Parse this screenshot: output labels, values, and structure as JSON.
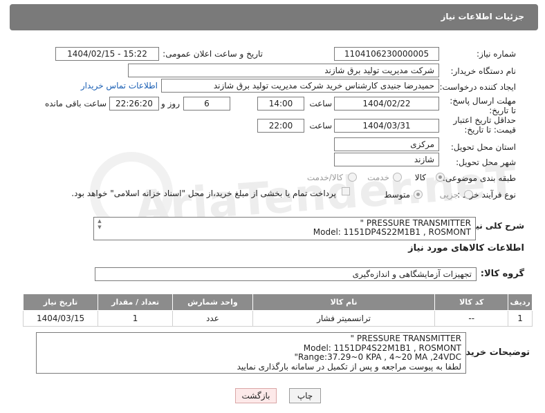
{
  "header": {
    "title": "جزئیات اطلاعات نیاز"
  },
  "watermark": "AriaTender.neT",
  "form": {
    "need_number": {
      "label": "شماره نیاز:",
      "value": "1104106230000005"
    },
    "announce_datetime": {
      "label": "تاریخ و ساعت اعلان عمومی:",
      "value": "1404/02/15 - 15:22"
    },
    "buyer_org": {
      "label": "نام دستگاه خریدار:",
      "value": "شرکت مدیریت تولید برق شازند"
    },
    "requester": {
      "label": "ایجاد کننده درخواست:",
      "value": "حمیدرضا جنیدی کارشناس خرید شرکت مدیریت تولید برق شازند",
      "contact_link": "اطلاعات تماس خریدار"
    },
    "reply_deadline": {
      "label": "مهلت ارسال پاسخ: تا تاریخ:",
      "date": "1404/02/22",
      "time_label": "ساعت",
      "time": "14:00",
      "days": "6",
      "days_label": "روز و",
      "remaining": "22:26:20",
      "remaining_label": "ساعت باقی مانده"
    },
    "price_validity": {
      "label": "حداقل تاریخ اعتبار قیمت: تا تاریخ:",
      "date": "1404/03/31",
      "time_label": "ساعت",
      "time": "22:00"
    },
    "province": {
      "label": "استان محل تحویل:",
      "value": "مرکزی"
    },
    "city": {
      "label": "شهر محل تحویل:",
      "value": "شازند"
    },
    "category": {
      "label": "طبقه بندی موضوعی:",
      "options": [
        "کالا",
        "خدمت",
        "کالا/خدمت"
      ],
      "selected": "کالا"
    },
    "process_type": {
      "label": "نوع فرآیند خرید :",
      "options": [
        "جزیی",
        "متوسط"
      ],
      "selected": "متوسط",
      "payment_note": "پرداخت تمام یا بخشی از مبلغ خرید،از محل \"اسناد خزانه اسلامی\" خواهد بود."
    },
    "description": {
      "label": "شرح کلی نیاز:",
      "lines": [
        "\" PRESSURE TRANSMITTER",
        "Model: 1151DP4S22M1B1 , ROSMONT"
      ]
    }
  },
  "goods_section": {
    "title": "اطلاعات کالاهای مورد نیاز",
    "group_label": "گروه کالا:",
    "group_value": "تجهیزات آزمایشگاهی و اندازه‌گیری"
  },
  "table": {
    "columns": [
      "ردیف",
      "کد کالا",
      "نام کالا",
      "واحد شمارش",
      "تعداد / مقدار",
      "تاریخ نیاز"
    ],
    "rows": [
      {
        "row": "1",
        "code": "--",
        "name": "ترانسمیتر فشار",
        "unit": "عدد",
        "qty": "1",
        "date": "1404/03/15"
      }
    ]
  },
  "buyer_notes": {
    "label": "توضیحات خریدار:",
    "lines": [
      "\" PRESSURE TRANSMITTER",
      "Model: 1151DP4S22M1B1 , ROSMONT",
      "\"Range:37.29~0 KPA , 4~20 MA ,24VDC",
      "لطفا به پیوست مراجعه و پس از تکمیل در سامانه بارگذاری نمایید"
    ]
  },
  "buttons": {
    "print": "چاپ",
    "back": "بازگشت"
  },
  "colors": {
    "header_bg": "#7a7a7a",
    "table_header_bg": "#8c8c8c",
    "link": "#1a5fb4",
    "back_button_bg": "#fde9e9"
  }
}
